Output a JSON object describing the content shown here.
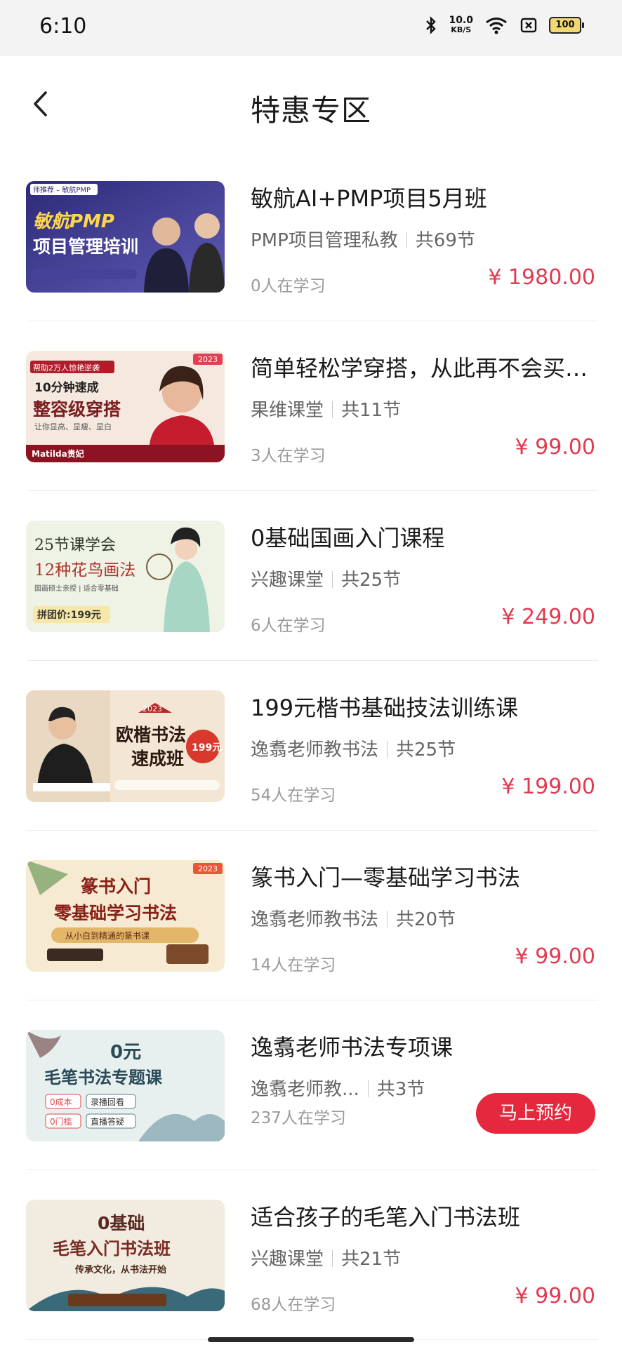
{
  "status_bar": {
    "time": "6:10",
    "net_speed": "10.0",
    "net_unit": "KB/S",
    "battery": "100"
  },
  "header": {
    "title": "特惠专区"
  },
  "courses": [
    {
      "title": "敏航AI+PMP项目5月班",
      "teacher": "PMP项目管理私教",
      "lessons": "共69节",
      "learners": "0人在学习",
      "price": "¥ 1980.00",
      "thumb": {
        "line1": "敏航PMP",
        "line2": "项目管理培训",
        "tag": "师推荐 – 敏航PMP"
      }
    },
    {
      "title": "简单轻松学穿搭，从此再不会买…",
      "teacher": "果维课堂",
      "lessons": "共11节",
      "learners": "3人在学习",
      "price": "¥ 99.00",
      "thumb": {
        "line1": "10分钟速成",
        "line2": "整容级穿搭",
        "tag": "帮助2万人惊艳逆袭",
        "badge": "2023",
        "sub": "让你显高、显瘦、显白",
        "foot": "Matilda贵妃"
      }
    },
    {
      "title": "0基础国画入门课程",
      "teacher": "兴趣课堂",
      "lessons": "共25节",
      "learners": "6人在学习",
      "price": "¥ 249.00",
      "thumb": {
        "line1": "25节课学会",
        "line2": "12种花鸟画法",
        "sub": "国画硕士亲授 | 适合零基础",
        "foot": "拼团价:199元"
      }
    },
    {
      "title": "199元楷书基础技法训练课",
      "teacher": "逸翥老师教书法",
      "lessons": "共25节",
      "learners": "54人在学习",
      "price": "¥ 199.00",
      "thumb": {
        "line1": "欧楷书法",
        "line2": "速成班",
        "badge": "2023",
        "tag": "199元"
      }
    },
    {
      "title": "篆书入门—零基础学习书法",
      "teacher": "逸翥老师教书法",
      "lessons": "共20节",
      "learners": "14人在学习",
      "price": "¥ 99.00",
      "thumb": {
        "line1": "篆书入门",
        "line2": "零基础学习书法",
        "badge": "2023",
        "sub": "从小白到精通的篆书课"
      }
    },
    {
      "title": "逸翥老师书法专项课",
      "teacher": "逸翥老师教...",
      "lessons": "共3节",
      "learners": "237人在学习",
      "reserve": "马上预约",
      "thumb": {
        "line1": "0元",
        "line2": "毛笔书法专题课",
        "chips": [
          "0成本",
          "录播回看",
          "0门槛",
          "直播答疑"
        ]
      }
    },
    {
      "title": "适合孩子的毛笔入门书法班",
      "teacher": "兴趣课堂",
      "lessons": "共21节",
      "learners": "68人在学习",
      "price": "¥ 99.00",
      "thumb": {
        "line1": "0基础",
        "line2": "毛笔入门书法班",
        "sub": "传承文化，从书法开始"
      }
    }
  ]
}
